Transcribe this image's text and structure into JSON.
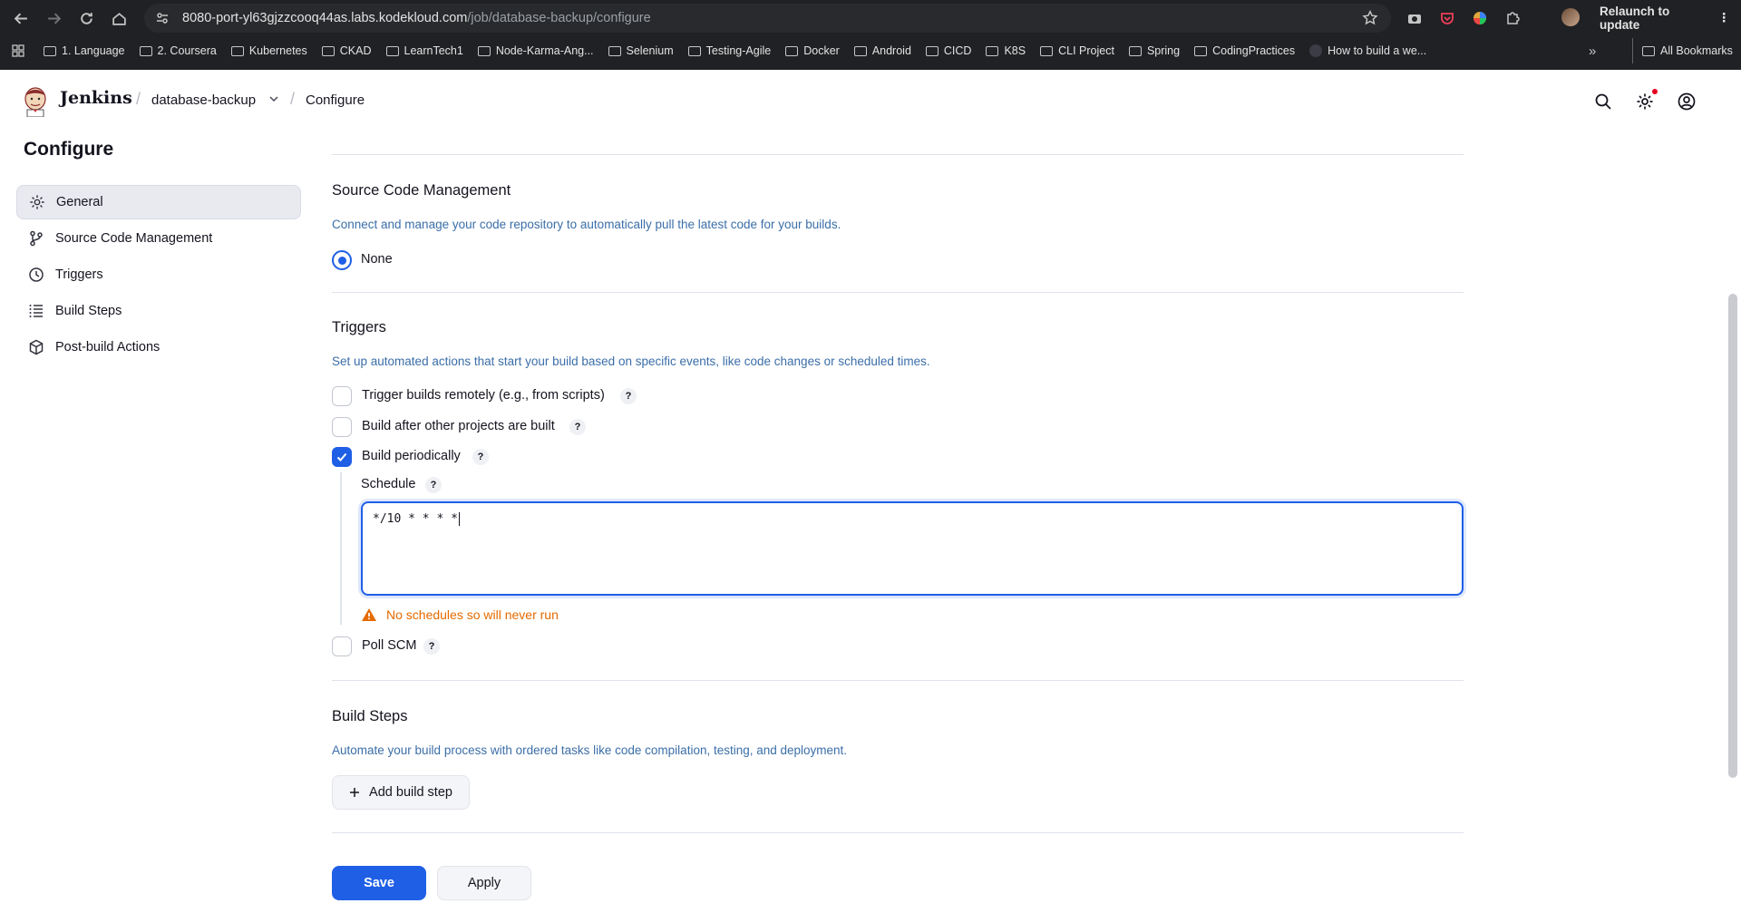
{
  "browser": {
    "url_host": "8080-port-yl63gjzzcooq44as.labs.kodekloud.com",
    "url_path": "/job/database-backup/configure",
    "relaunch_label": "Relaunch to update",
    "bookmarks": [
      "1. Language",
      "2. Coursera",
      "Kubernetes",
      "CKAD",
      "LearnTech1",
      "Node-Karma-Ang...",
      "Selenium",
      "Testing-Agile",
      "Docker",
      "Android",
      "CICD",
      "K8S",
      "CLI Project",
      "Spring",
      "CodingPractices",
      "How to build a we..."
    ],
    "all_bookmarks_label": "All Bookmarks",
    "more_label": "»"
  },
  "header": {
    "brand": "Jenkins",
    "crumb_sep": "/",
    "job_name": "database-backup",
    "page": "Configure"
  },
  "page_title": "Configure",
  "sidebar": {
    "items": [
      {
        "label": "General",
        "icon": "gear-icon",
        "active": true
      },
      {
        "label": "Source Code Management",
        "icon": "branch-icon"
      },
      {
        "label": "Triggers",
        "icon": "clock-icon"
      },
      {
        "label": "Build Steps",
        "icon": "list-icon"
      },
      {
        "label": "Post-build Actions",
        "icon": "package-icon"
      }
    ]
  },
  "scm": {
    "title": "Source Code Management",
    "description": "Connect and manage your code repository to automatically pull the latest code for your builds.",
    "option_none": "None"
  },
  "triggers": {
    "title": "Triggers",
    "description": "Set up automated actions that start your build based on specific events, like code changes or scheduled times.",
    "remote": "Trigger builds remotely (e.g., from scripts)",
    "after_other": "Build after other projects are built",
    "periodically": "Build periodically",
    "schedule_label": "Schedule",
    "schedule_value": "*/10 * * * *",
    "warning": "No schedules so will never run",
    "poll_scm": "Poll SCM",
    "help": "?"
  },
  "build_steps": {
    "title": "Build Steps",
    "description": "Automate your build process with ordered tasks like code compilation, testing, and deployment.",
    "add_label": "Add build step"
  },
  "actions": {
    "save": "Save",
    "apply": "Apply"
  },
  "colors": {
    "accent": "#1f5fe6",
    "warning": "#e56a00",
    "description": "#3b6ea8"
  }
}
